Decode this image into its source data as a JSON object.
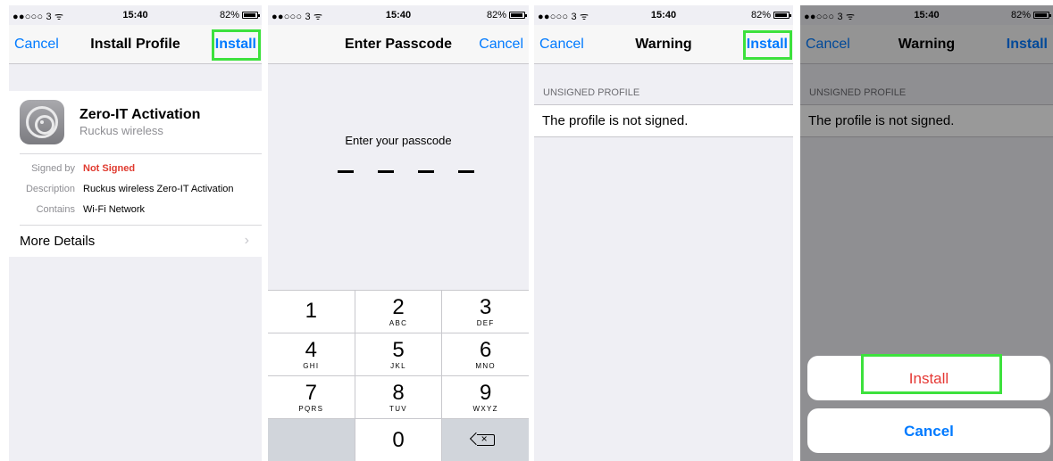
{
  "status_bar": {
    "carrier": "●●○○○ 3 ᯤ",
    "time": "15:40",
    "battery": "82%"
  },
  "screen1": {
    "nav": {
      "left": "Cancel",
      "title": "Install Profile",
      "right": "Install"
    },
    "profile": {
      "name": "Zero-IT Activation",
      "org": "Ruckus wireless",
      "icon": "settings-gear-icon"
    },
    "details": [
      {
        "key": "Signed by",
        "value": "Not Signed"
      },
      {
        "key": "Description",
        "value": "Ruckus wireless Zero-IT Activation"
      },
      {
        "key": "Contains",
        "value": "Wi-Fi Network"
      }
    ],
    "more_details": "More Details",
    "chevron": "›"
  },
  "screen2": {
    "nav": {
      "title": "Enter Passcode",
      "right": "Cancel"
    },
    "prompt": "Enter your passcode",
    "keys": [
      {
        "num": "1",
        "letters": ""
      },
      {
        "num": "2",
        "letters": "ABC"
      },
      {
        "num": "3",
        "letters": "DEF"
      },
      {
        "num": "4",
        "letters": "GHI"
      },
      {
        "num": "5",
        "letters": "JKL"
      },
      {
        "num": "6",
        "letters": "MNO"
      },
      {
        "num": "7",
        "letters": "PQRS"
      },
      {
        "num": "8",
        "letters": "TUV"
      },
      {
        "num": "9",
        "letters": "WXYZ"
      },
      {
        "num": "0",
        "letters": ""
      }
    ]
  },
  "screen3": {
    "nav": {
      "left": "Cancel",
      "title": "Warning",
      "right": "Install"
    },
    "section_header": "UNSIGNED PROFILE",
    "message": "The profile is not signed."
  },
  "screen4": {
    "nav": {
      "left": "Cancel",
      "title": "Warning",
      "right": "Install"
    },
    "section_header": "UNSIGNED PROFILE",
    "message": "The profile is not signed.",
    "sheet": {
      "install": "Install",
      "cancel": "Cancel"
    }
  },
  "colors": {
    "ios_blue": "#007aff",
    "destructive_red": "#e53935",
    "highlight_green": "#3de13d"
  }
}
